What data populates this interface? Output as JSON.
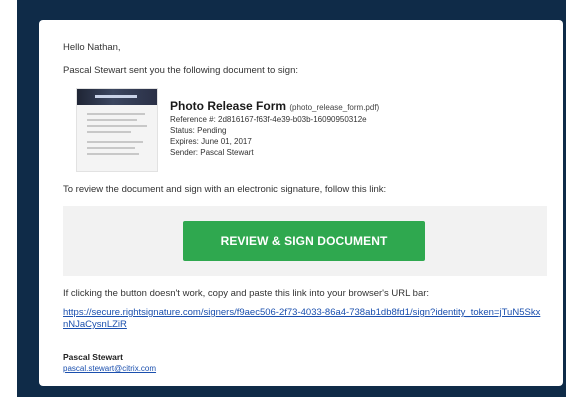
{
  "email": {
    "greeting": "Hello Nathan,",
    "intro": "Pascal Stewart sent you the following document to sign:",
    "document": {
      "title": "Photo Release Form",
      "filename": "(photo_release_form.pdf)",
      "reference": "Reference #: 2d816167-f63f-4e39-b03b-1609095031​2e",
      "status": "Status: Pending",
      "expires": "Expires: June 01, 2017",
      "sender": "Sender: Pascal Stewart"
    },
    "review_text": "To review the document and sign with an electronic signature, follow this link:",
    "cta_label": "REVIEW & SIGN DOCUMENT",
    "fallback_text": "If clicking the button doesn't work, copy and paste this link into your browser's URL bar:",
    "link_url": "https://secure.rightsignature.com/signers/f9aec506-2f73-4033-86a4-738ab1db8fd1/sign?identity_token=jTuN5SkxnNJaCysnLZiR",
    "signature": {
      "name": "Pascal Stewart",
      "email": "pascal.stewart@citrix.com"
    }
  },
  "colors": {
    "frame": "#0f2b48",
    "button": "#2fa84f",
    "link": "#1a4fae"
  }
}
